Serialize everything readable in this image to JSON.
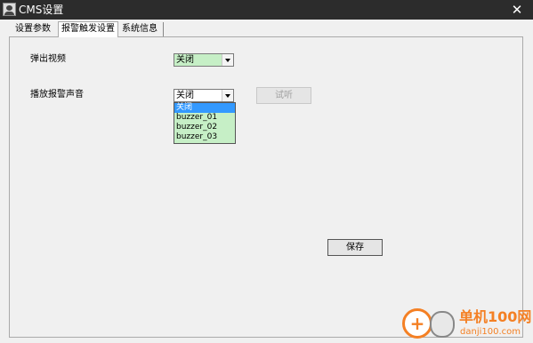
{
  "window": {
    "title": "CMS设置",
    "close_label": "✕"
  },
  "tabs": [
    {
      "label": "设置参数"
    },
    {
      "label": "报警触发设置",
      "active": true
    },
    {
      "label": "系统信息"
    }
  ],
  "form": {
    "popup_video": {
      "label": "弹出视频",
      "value": "关闭"
    },
    "alarm_sound": {
      "label": "播放报警声音",
      "value": "关闭",
      "options": [
        "关闭",
        "buzzer_01",
        "buzzer_02",
        "buzzer_03"
      ],
      "highlighted_option": "关闭"
    },
    "test_button": "试听",
    "save_button": "保存"
  },
  "watermark": {
    "title": "单机100网",
    "url": "danji100.com"
  },
  "colors": {
    "titlebar": "#2c2c2c",
    "combo_highlight": "#c6efc6",
    "selection": "#3399ff",
    "watermark": "#f48024"
  }
}
